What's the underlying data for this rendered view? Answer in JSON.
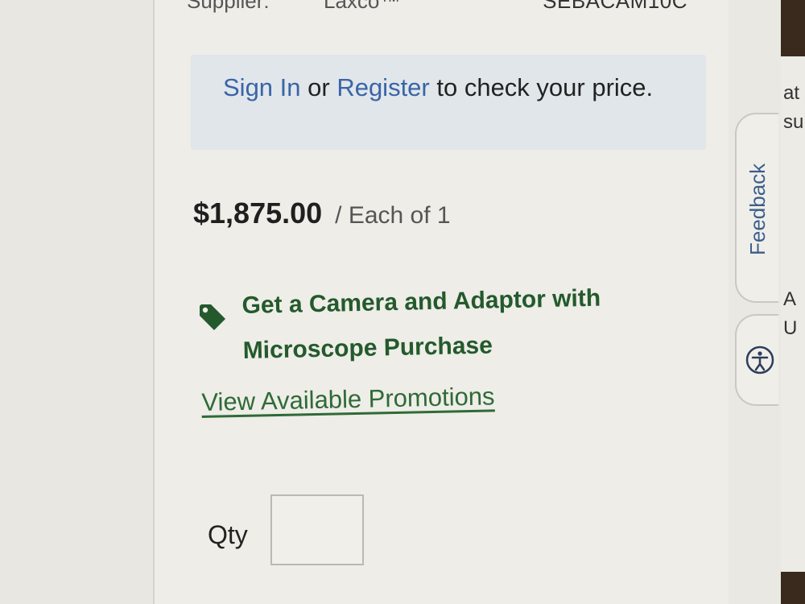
{
  "supplier": {
    "label": "Supplier:",
    "value": "Laxco™",
    "sku": "SEBACAM10C"
  },
  "pricing_notice": {
    "sign_in_link": "Sign In",
    "or_text": " or ",
    "register_link": "Register",
    "suffix_text": " to check your price."
  },
  "price": {
    "amount": "$1,875.00",
    "unit": "/ Each of 1"
  },
  "promotion": {
    "icon": "tag-icon",
    "text": "Get a Camera and Adaptor with Microscope Purchase",
    "link_label": "View Available Promotions",
    "color": "#245a2c"
  },
  "quantity": {
    "label": "Qty",
    "value": ""
  },
  "side_tabs": {
    "feedback_label": "Feedback",
    "accessibility_icon": "accessibility-icon"
  },
  "edge_fragments": [
    "at",
    "su",
    "A",
    "U"
  ]
}
